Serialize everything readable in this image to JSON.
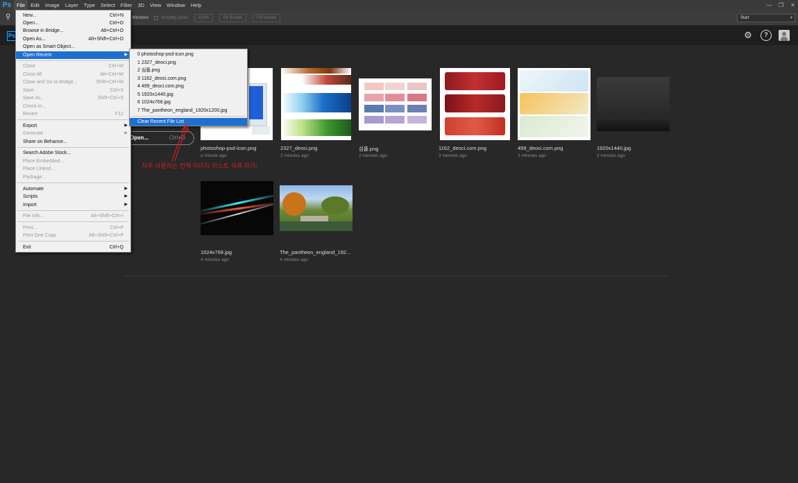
{
  "menubar": {
    "logo": "Ps",
    "items": [
      "File",
      "Edit",
      "Image",
      "Layer",
      "Type",
      "Select",
      "Filter",
      "3D",
      "View",
      "Window",
      "Help"
    ]
  },
  "options_bar": {
    "windows_label": "Windows",
    "scrubby_zoom_label": "Scrubby Zoom",
    "zoom_100": "100%",
    "fit_screen": "Fit Screen",
    "fill_screen": "Fill Screen",
    "workspace": "Start"
  },
  "start_header": {
    "logo": "Ps"
  },
  "file_menu": {
    "items": [
      {
        "label": "New...",
        "shortcut": "Ctrl+N",
        "enabled": true
      },
      {
        "label": "Open...",
        "shortcut": "Ctrl+O",
        "enabled": true
      },
      {
        "label": "Browse in Bridge...",
        "shortcut": "Alt+Ctrl+O",
        "enabled": true
      },
      {
        "label": "Open As...",
        "shortcut": "Alt+Shift+Ctrl+O",
        "enabled": true
      },
      {
        "label": "Open as Smart Object...",
        "shortcut": "",
        "enabled": true
      },
      {
        "label": "Open Recent",
        "shortcut": "",
        "enabled": true
      },
      {
        "label": "Close",
        "shortcut": "Ctrl+W",
        "enabled": false
      },
      {
        "label": "Close All",
        "shortcut": "Alt+Ctrl+W",
        "enabled": false
      },
      {
        "label": "Close and Go to Bridge...",
        "shortcut": "Shift+Ctrl+W",
        "enabled": false
      },
      {
        "label": "Save",
        "shortcut": "Ctrl+S",
        "enabled": false
      },
      {
        "label": "Save As...",
        "shortcut": "Shift+Ctrl+S",
        "enabled": false
      },
      {
        "label": "Check In...",
        "shortcut": "",
        "enabled": false
      },
      {
        "label": "Revert",
        "shortcut": "F12",
        "enabled": false
      },
      {
        "label": "Export",
        "shortcut": "",
        "enabled": true
      },
      {
        "label": "Generate",
        "shortcut": "",
        "enabled": false
      },
      {
        "label": "Share on Behance...",
        "shortcut": "",
        "enabled": true
      },
      {
        "label": "Search Adobe Stock...",
        "shortcut": "",
        "enabled": true
      },
      {
        "label": "Place Embedded...",
        "shortcut": "",
        "enabled": false
      },
      {
        "label": "Place Linked...",
        "shortcut": "",
        "enabled": false
      },
      {
        "label": "Package...",
        "shortcut": "",
        "enabled": false
      },
      {
        "label": "Automate",
        "shortcut": "",
        "enabled": true
      },
      {
        "label": "Scripts",
        "shortcut": "",
        "enabled": true
      },
      {
        "label": "Import",
        "shortcut": "",
        "enabled": true
      },
      {
        "label": "File Info...",
        "shortcut": "Alt+Shift+Ctrl+I",
        "enabled": false
      },
      {
        "label": "Print...",
        "shortcut": "Ctrl+P",
        "enabled": false
      },
      {
        "label": "Print One Copy",
        "shortcut": "Alt+Shift+Ctrl+P",
        "enabled": false
      },
      {
        "label": "Exit",
        "shortcut": "Ctrl+Q",
        "enabled": true
      }
    ]
  },
  "recent_submenu": {
    "items": [
      "0  photoshop-psd-icon.png",
      "1  2327_deoci.png",
      "2  심플.png",
      "3  1162_deoci.com.png",
      "4  499_deoci.com.png",
      "5  1920x1440.jpg",
      "6  1024x768.jpg",
      "7  The_pantheon_england_1920x1200.jpg"
    ],
    "clear_label": "Clear Recent File List"
  },
  "open_button": {
    "label": "Open...",
    "shortcut": "Ctrl+O"
  },
  "annotation": "자주 사용하는 전체 이미지 리스트 삭제 하기!",
  "recent_files": [
    {
      "name": "photoshop-psd-icon.png",
      "time": "a minute ago"
    },
    {
      "name": "2327_deoci.png",
      "time": "2 minutes ago"
    },
    {
      "name": "심플.png",
      "time": "2 minutes ago"
    },
    {
      "name": "1162_deoci.com.png",
      "time": "3 minutes ago"
    },
    {
      "name": "499_deoci.com.png",
      "time": "3 minutes ago"
    },
    {
      "name": "1920x1440.jpg",
      "time": "3 minutes ago"
    },
    {
      "name": "1024x768.jpg",
      "time": "4 minutes ago"
    },
    {
      "name": "The_pantheon_england_192...",
      "time": "4 minutes ago"
    }
  ],
  "colors": {
    "accent": "#31a8ff",
    "menu_highlight": "#1e6fd1",
    "annotation": "#d21e1e"
  }
}
